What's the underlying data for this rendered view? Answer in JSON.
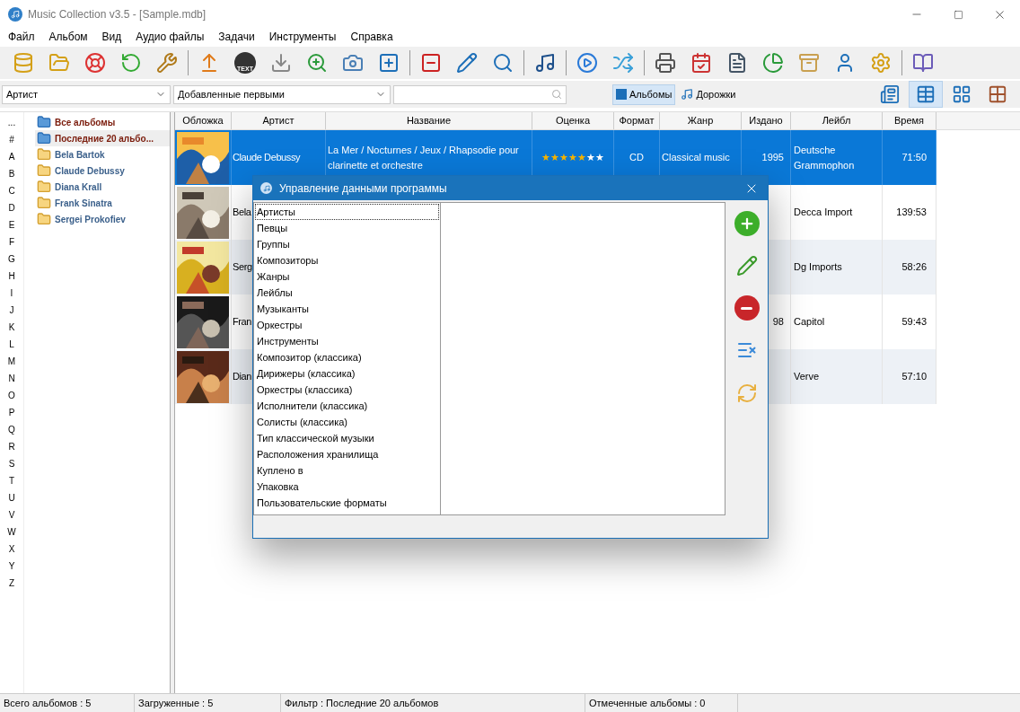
{
  "window": {
    "title": "Music Collection v3.5 - [Sample.mdb]"
  },
  "menu": [
    "Файл",
    "Альбом",
    "Вид",
    "Аудио файлы",
    "Задачи",
    "Инструменты",
    "Справка"
  ],
  "toolbar": {
    "cd_text_badge": "TEXT"
  },
  "filter_bar": {
    "group_by": "Артист",
    "sort": "Добавленные первыми",
    "modes": [
      {
        "label": "Альбомы",
        "selected": true
      },
      {
        "label": "Дорожки",
        "selected": false
      }
    ],
    "views": [
      {
        "selected": false
      },
      {
        "selected": true
      },
      {
        "selected": false
      },
      {
        "selected": false
      }
    ]
  },
  "alphabet": [
    "...",
    "#",
    "A",
    "B",
    "C",
    "D",
    "E",
    "F",
    "G",
    "H",
    "I",
    "J",
    "K",
    "L",
    "M",
    "N",
    "O",
    "P",
    "Q",
    "R",
    "S",
    "T",
    "U",
    "V",
    "W",
    "X",
    "Y",
    "Z"
  ],
  "tree": [
    {
      "label": "Все альбомы",
      "kind": "smart",
      "selected": false
    },
    {
      "label": "Последние 20 альбо...",
      "kind": "smart",
      "selected": true
    },
    {
      "label": "Bela Bartok",
      "kind": "folder",
      "selected": false
    },
    {
      "label": "Claude Debussy",
      "kind": "folder",
      "selected": false
    },
    {
      "label": "Diana Krall",
      "kind": "folder",
      "selected": false
    },
    {
      "label": "Frank Sinatra",
      "kind": "folder",
      "selected": false
    },
    {
      "label": "Sergei Prokofiev",
      "kind": "folder",
      "selected": false
    }
  ],
  "table": {
    "columns": [
      "Обложка",
      "Артист",
      "Название",
      "Оценка",
      "Формат",
      "Жанр",
      "Издано",
      "Лейбл",
      "Время"
    ],
    "rows": [
      {
        "selected": true,
        "artist": "Claude Debussy",
        "title": "La Mer / Nocturnes / Jeux / Rhapsodie pour clarinette et orchestre",
        "stars": 5,
        "format": "CD",
        "genre": "Classical music",
        "year": "1995",
        "label": "Deutsche Grammophon",
        "time": "71:50"
      },
      {
        "selected": false,
        "artist": "Bela",
        "label": "Decca Import",
        "time": "139:53"
      },
      {
        "selected": false,
        "artist": "Serg",
        "label": "Dg Imports",
        "time": "58:26"
      },
      {
        "selected": false,
        "artist": "Fran",
        "year": "98",
        "label": "Capitol",
        "time": "59:43"
      },
      {
        "selected": false,
        "artist": "Dian",
        "label": "Verve",
        "time": "57:10"
      }
    ]
  },
  "dialog": {
    "title": "Управление данными программы",
    "items": [
      {
        "label": "Артисты",
        "selected": true
      },
      {
        "label": "Певцы",
        "selected": false
      },
      {
        "label": "Группы",
        "selected": false
      },
      {
        "label": "Композиторы",
        "selected": false
      },
      {
        "label": "Жанры",
        "selected": false
      },
      {
        "label": "Лейблы",
        "selected": false
      },
      {
        "label": "Музыканты",
        "selected": false
      },
      {
        "label": "Оркестры",
        "selected": false
      },
      {
        "label": "Инструменты",
        "selected": false
      },
      {
        "label": "Композитор (классика)",
        "selected": false
      },
      {
        "label": "Дирижеры (классика)",
        "selected": false
      },
      {
        "label": "Оркестры (классика)",
        "selected": false
      },
      {
        "label": "Исполнители (классика)",
        "selected": false
      },
      {
        "label": "Солисты (классика)",
        "selected": false
      },
      {
        "label": "Тип классической музыки",
        "selected": false
      },
      {
        "label": "Расположения хранилища",
        "selected": false
      },
      {
        "label": "Куплено в",
        "selected": false
      },
      {
        "label": "Упаковка",
        "selected": false
      },
      {
        "label": "Пользовательские форматы",
        "selected": false
      }
    ]
  },
  "status_bar": [
    "Всего альбомов : 5",
    "Загруженные : 5",
    "Фильтр : Последние 20 альбомов",
    "Отмеченные альбомы : 0"
  ]
}
